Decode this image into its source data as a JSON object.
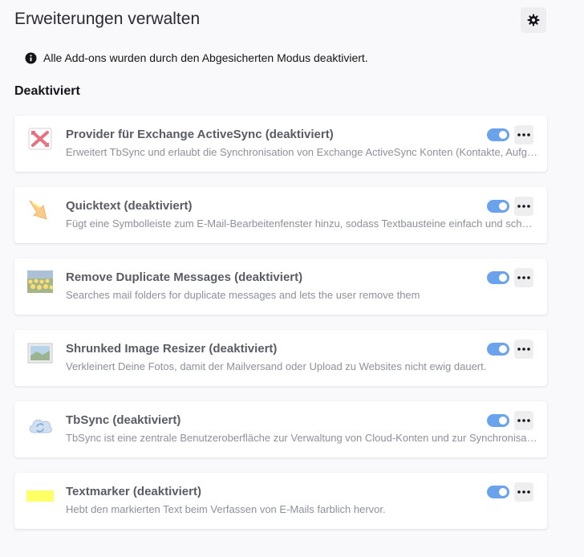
{
  "header": {
    "title": "Erweiterungen verwalten",
    "settings_icon": "gear-icon"
  },
  "notice": {
    "icon": "info-icon",
    "text": "Alle Add-ons wurden durch den Abgesicherten Modus deaktiviert."
  },
  "section": {
    "heading": "Deaktiviert"
  },
  "addons": [
    {
      "name": "Provider für Exchange ActiveSync (deaktiviert)",
      "description": "Erweitert TbSync und erlaubt die Synchronisation von Exchange ActiveSync Konten (Kontakte, Aufgaben und Kalender)",
      "icon": "exchange-icon",
      "enabled": true
    },
    {
      "name": "Quicktext (deaktiviert)",
      "description": "Fügt eine Symbolleiste zum E-Mail-Bearbeitenfenster hinzu, sodass Textbausteine einfach und schnell eingefügt werden können",
      "icon": "quicktext-icon",
      "enabled": true
    },
    {
      "name": "Remove Duplicate Messages (deaktiviert)",
      "description": "Searches mail folders for duplicate messages and lets the user remove them",
      "icon": "sunflower-field-icon",
      "enabled": true
    },
    {
      "name": "Shrunked Image Resizer (deaktiviert)",
      "description": "Verkleinert Deine Fotos, damit der Mailversand oder Upload zu Websites nicht ewig dauert.",
      "icon": "landscape-picture-icon",
      "enabled": true
    },
    {
      "name": "TbSync (deaktiviert)",
      "description": "TbSync ist eine zentrale Benutzeroberfläche zur Verwaltung von Cloud-Konten und zur Synchronisation",
      "icon": "cloud-sync-icon",
      "enabled": true
    },
    {
      "name": "Textmarker (deaktiviert)",
      "description": "Hebt den markierten Text beim Verfassen von E-Mails farblich hervor.",
      "icon": "highlighter-icon",
      "enabled": true
    }
  ],
  "colors": {
    "toggle_on": "#0060df",
    "page_background": "#f9f9fb",
    "highlighter": "#ffff66"
  }
}
